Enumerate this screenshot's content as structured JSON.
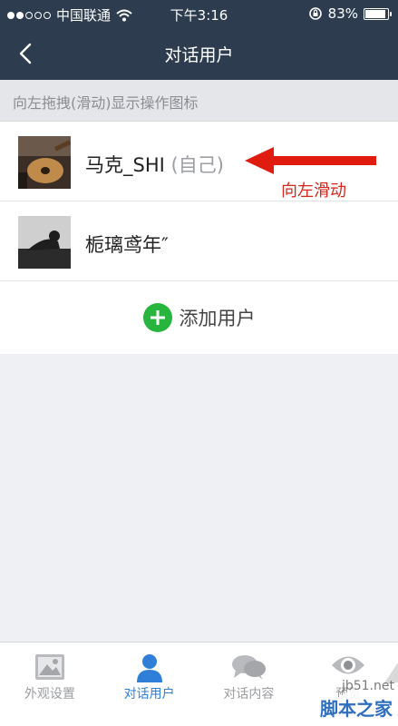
{
  "status_bar": {
    "carrier": "中国联通",
    "time": "下午3:16",
    "battery": "83%",
    "battery_level": 0.83
  },
  "nav": {
    "title": "对话用户"
  },
  "hint": "向左拖拽(滑动)显示操作图标",
  "users": [
    {
      "name": "马克_SHI",
      "suffix": "(自己)"
    },
    {
      "name": "栀璃鸢年″",
      "suffix": ""
    }
  ],
  "annotation": {
    "label": "向左滑动",
    "color": "#d6261b"
  },
  "add_user_label": "添加用户",
  "tabs": [
    {
      "label": "外观设置",
      "icon": "image-icon",
      "active": false
    },
    {
      "label": "对话用户",
      "icon": "user-icon",
      "active": true
    },
    {
      "label": "对话内容",
      "icon": "chat-bubbles-icon",
      "active": false
    },
    {
      "label": "预览",
      "icon": "eye-icon",
      "active": false
    }
  ],
  "watermark": {
    "url": "jb51.net",
    "text": "脚本之家"
  },
  "colors": {
    "header": "#2d3d4f",
    "accent": "#2f7fd8",
    "add": "#28b53d"
  }
}
